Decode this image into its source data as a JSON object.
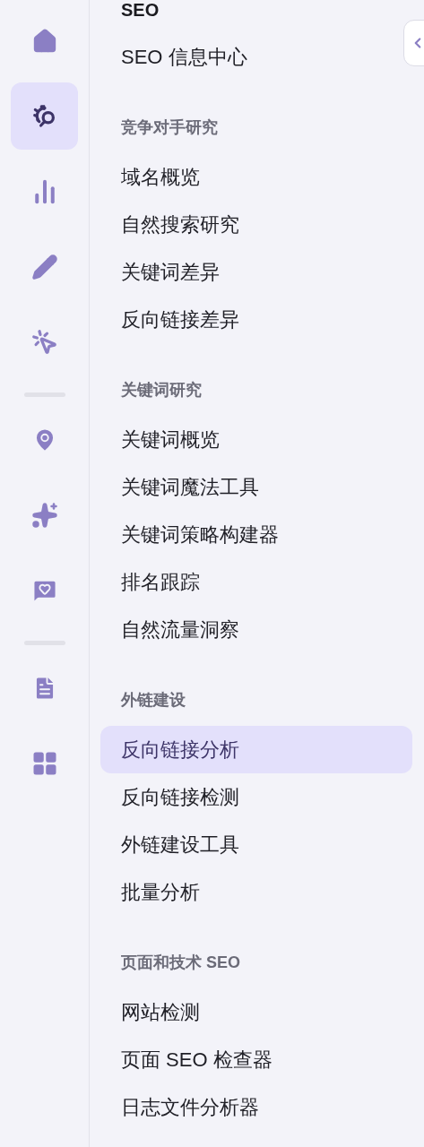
{
  "rail": [
    {
      "kind": "button",
      "selected": false
    },
    {
      "kind": "button",
      "selected": true
    },
    {
      "kind": "button",
      "selected": false
    },
    {
      "kind": "button",
      "selected": false
    },
    {
      "kind": "button",
      "selected": false
    },
    {
      "kind": "divider"
    },
    {
      "kind": "button",
      "selected": false
    },
    {
      "kind": "button",
      "selected": false
    },
    {
      "kind": "button",
      "selected": false
    },
    {
      "kind": "divider"
    },
    {
      "kind": "button",
      "selected": false
    },
    {
      "kind": "button",
      "selected": false
    }
  ],
  "menu": {
    "title": "SEO",
    "sections": [
      {
        "items": [
          {
            "label": "SEO 信息中心",
            "selected": false
          }
        ]
      },
      {
        "heading": "竞争对手研究",
        "items": [
          {
            "label": "域名概览",
            "selected": false
          },
          {
            "label": "自然搜索研究",
            "selected": false
          },
          {
            "label": "关键词差异",
            "selected": false
          },
          {
            "label": "反向链接差异",
            "selected": false
          }
        ]
      },
      {
        "heading": "关键词研究",
        "items": [
          {
            "label": "关键词概览",
            "selected": false
          },
          {
            "label": "关键词魔法工具",
            "selected": false
          },
          {
            "label": "关键词策略构建器",
            "selected": false
          },
          {
            "label": "排名跟踪",
            "selected": false
          },
          {
            "label": "自然流量洞察",
            "selected": false
          }
        ]
      },
      {
        "heading": "外链建设",
        "items": [
          {
            "label": "反向链接分析",
            "selected": true
          },
          {
            "label": "反向链接检测",
            "selected": false
          },
          {
            "label": "外链建设工具",
            "selected": false
          },
          {
            "label": "批量分析",
            "selected": false
          }
        ]
      },
      {
        "heading": "页面和技术 SEO",
        "items": [
          {
            "label": "网站检测",
            "selected": false
          },
          {
            "label": "页面 SEO 检查器",
            "selected": false
          },
          {
            "label": "日志文件分析器",
            "selected": false
          }
        ]
      }
    ]
  }
}
